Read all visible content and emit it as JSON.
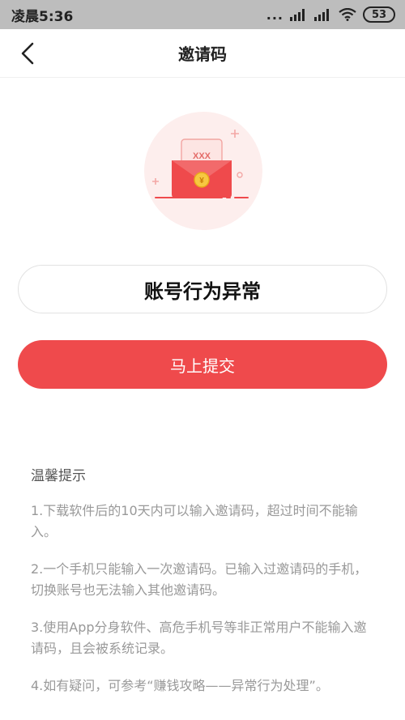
{
  "status_bar": {
    "time": "凌晨5:36",
    "dots": "...",
    "battery": "53"
  },
  "header": {
    "title": "邀请码"
  },
  "hero": {
    "envelope_text": "XXX",
    "coin_symbol": "¥",
    "accent_color": "#ef4a4c"
  },
  "invite": {
    "value": "账号行为异常"
  },
  "submit_button": {
    "label": "马上提交"
  },
  "tips": {
    "title": "温馨提示",
    "items": [
      "1.下载软件后的10天内可以输入邀请码，超过时间不能输入。",
      "2.一个手机只能输入一次邀请码。已输入过邀请码的手机，切换账号也无法输入其他邀请码。",
      "3.使用App分身软件、高危手机号等非正常用户不能输入邀请码，且会被系统记录。",
      "4.如有疑问，可参考“赚钱攻略——异常行为处理”。"
    ]
  }
}
